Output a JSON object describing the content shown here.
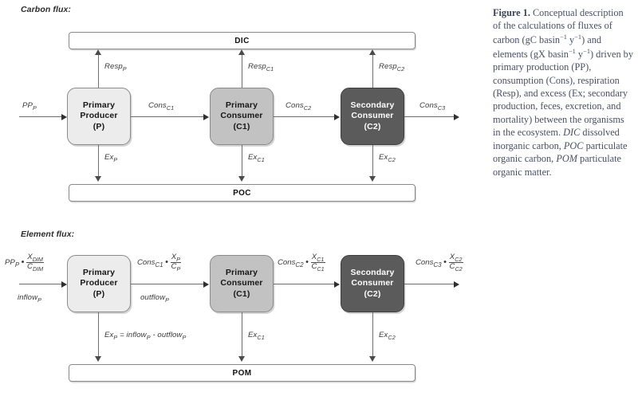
{
  "figure": {
    "carbon_section_heading": "Carbon flux:",
    "element_section_heading": "Element flux:"
  },
  "carbon_flux": {
    "pools": {
      "top": "DIC",
      "bottom": "POC"
    },
    "organisms": [
      {
        "line1": "Primary",
        "line2": "Producer",
        "line3": "(P)",
        "shade": "light"
      },
      {
        "line1": "Primary",
        "line2": "Consumer",
        "line3": "(C1)",
        "shade": "medium"
      },
      {
        "line1": "Secondary",
        "line2": "Consumer",
        "line3": "(C2)",
        "shade": "dark"
      }
    ],
    "inputs": [
      {
        "base": "PP",
        "sub": "P"
      }
    ],
    "respiration": [
      {
        "base": "Resp",
        "sub": "P"
      },
      {
        "base": "Resp",
        "sub": "C1"
      },
      {
        "base": "Resp",
        "sub": "C2"
      }
    ],
    "consumption": [
      {
        "base": "Cons",
        "sub": "C1"
      },
      {
        "base": "Cons",
        "sub": "C2"
      },
      {
        "base": "Cons",
        "sub": "C3"
      }
    ],
    "excess": [
      {
        "base": "Ex",
        "sub": "P"
      },
      {
        "base": "Ex",
        "sub": "C1"
      },
      {
        "base": "Ex",
        "sub": "C2"
      }
    ]
  },
  "element_flux": {
    "pools": {
      "bottom": "POM"
    },
    "organisms": [
      {
        "line1": "Primary",
        "line2": "Producer",
        "line3": "(P)",
        "shade": "light"
      },
      {
        "line1": "Primary",
        "line2": "Consumer",
        "line3": "(C1)",
        "shade": "medium"
      },
      {
        "line1": "Secondary",
        "line2": "Consumer",
        "line3": "(C2)",
        "shade": "dark"
      }
    ],
    "flows": [
      {
        "base": "PP",
        "base_sub": "P",
        "num": "X",
        "num_sub": "DIM",
        "den": "C",
        "den_sub": "DIM",
        "under_base": "inflow",
        "under_sub": "P"
      },
      {
        "base": "Cons",
        "base_sub": "C1",
        "num": "X",
        "num_sub": "P",
        "den": "C",
        "den_sub": "P",
        "under_base": "outflow",
        "under_sub": "P"
      },
      {
        "base": "Cons",
        "base_sub": "C2",
        "num": "X",
        "num_sub": "C1",
        "den": "C",
        "den_sub": "C1",
        "under_base": "",
        "under_sub": ""
      },
      {
        "base": "Cons",
        "base_sub": "C3",
        "num": "X",
        "num_sub": "C2",
        "den": "C",
        "den_sub": "C2",
        "under_base": "",
        "under_sub": ""
      }
    ],
    "excess": [
      {
        "base": "Ex",
        "sub": "P",
        "equation": " = inflow",
        "eq_sub1": "P",
        "eq_mid": " - outflow",
        "eq_sub2": "P"
      },
      {
        "base": "Ex",
        "sub": "C1"
      },
      {
        "base": "Ex",
        "sub": "C2"
      }
    ]
  },
  "caption": {
    "label": "Figure 1.",
    "text_part1": " Conceptual description of the calculations of fluxes of carbon (gC basin",
    "sup1": "−1",
    "text_part2": " y",
    "sup2": "−1",
    "text_part3": ") and elements (gX basin",
    "sup3": "−1",
    "text_part4": " y",
    "sup4": "−1",
    "text_part5": ") driven by primary production (PP), consumption (Cons), respiration (Resp), and excess (Ex; secondary production, feces, excretion, and mortality) between the organisms in the ecosystem. ",
    "italic1": "DIC",
    "text_part6": " dissolved inorganic carbon, ",
    "italic2": "POC",
    "text_part7": " particulate organic carbon, ",
    "italic3": "POM",
    "text_part8": " particulate organic matter."
  }
}
